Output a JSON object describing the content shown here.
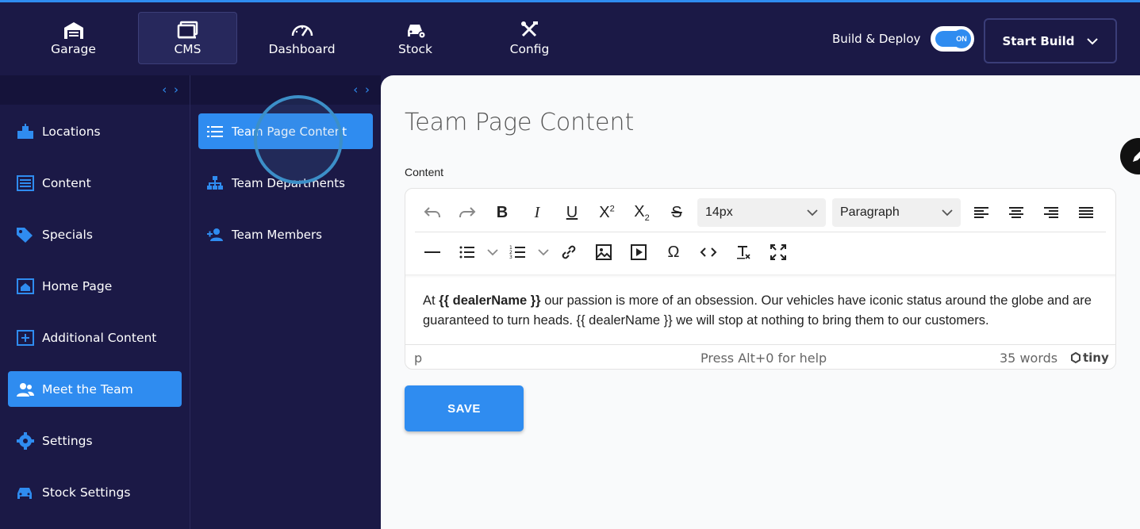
{
  "top_nav": {
    "items": [
      {
        "label": "Garage",
        "icon": "garage-icon"
      },
      {
        "label": "CMS",
        "icon": "cms-icon"
      },
      {
        "label": "Dashboard",
        "icon": "dashboard-icon"
      },
      {
        "label": "Stock",
        "icon": "stock-icon"
      },
      {
        "label": "Config",
        "icon": "config-icon"
      }
    ],
    "active": "CMS",
    "build_deploy_label": "Build & Deploy",
    "toggle_label": "ON",
    "start_build_label": "Start Build"
  },
  "sidebar": {
    "items": [
      {
        "label": "Locations"
      },
      {
        "label": "Content"
      },
      {
        "label": "Specials"
      },
      {
        "label": "Home Page"
      },
      {
        "label": "Additional Content"
      },
      {
        "label": "Meet the Team"
      },
      {
        "label": "Settings"
      },
      {
        "label": "Stock Settings"
      }
    ],
    "active": "Meet the Team"
  },
  "subnav": {
    "items": [
      {
        "label": "Team Page Content"
      },
      {
        "label": "Team Departments"
      },
      {
        "label": "Team Members"
      }
    ],
    "active": "Team Page Content"
  },
  "main": {
    "title": "Team Page Content",
    "content_label": "Content",
    "editor": {
      "font_size": "14px",
      "block_format": "Paragraph",
      "body_prefix": "At ",
      "body_bold": "{{ dealerName }}",
      "body_rest": " our passion is more of an obsession. Our vehicles have iconic status around the globe and are guaranteed to turn heads. {{ dealerName }} we will stop at nothing to bring them to our customers.",
      "status_path": "p",
      "status_help": "Press Alt+0 for help",
      "word_count": "35 words",
      "brand": "tiny"
    },
    "save_label": "SAVE"
  },
  "colors": {
    "nav_bg": "#1b1946",
    "accent": "#2f8cf0",
    "main_bg": "#f9fafb"
  }
}
